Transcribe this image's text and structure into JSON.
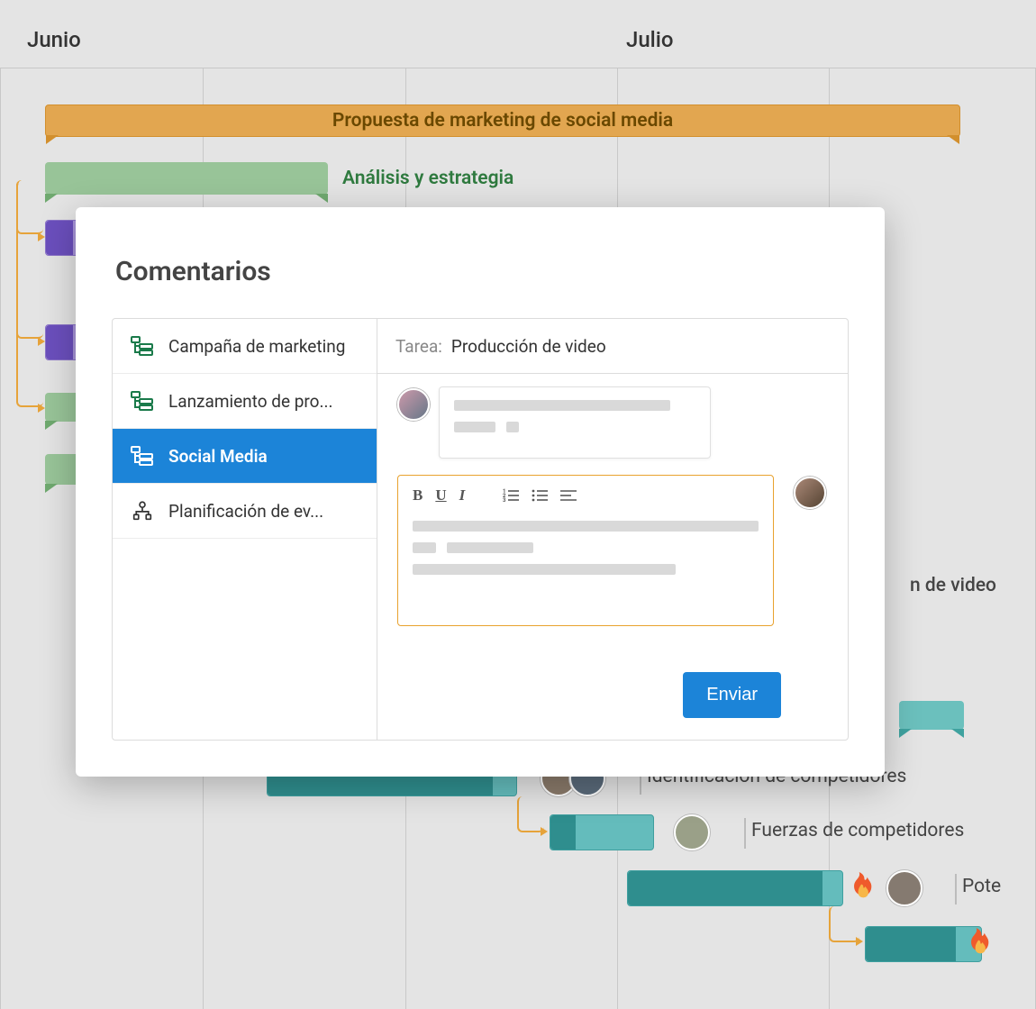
{
  "timeline": {
    "months": [
      "Junio",
      "Julio"
    ]
  },
  "gantt": {
    "main_bar": "Propuesta de marketing de social media",
    "row1_label": "Análisis y estrategia",
    "row5_label_partial": "n de video",
    "row6_label": "Identificación de competidores",
    "row7_label": "Fuerzas de competidores",
    "row8_label_partial": "Pote"
  },
  "modal": {
    "title": "Comentarios",
    "list": [
      "Campaña de marketing",
      "Lanzamiento de pro...",
      "Social Media",
      "Planificación de ev..."
    ],
    "task_key": "Tarea:",
    "task_value": "Producción de video",
    "send": "Enviar"
  },
  "colors": {
    "accent_blue": "#1c84d8",
    "accent_orange": "#e8a22e"
  }
}
